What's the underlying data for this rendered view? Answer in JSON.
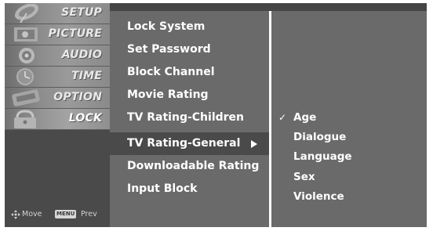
{
  "sidebar": {
    "items": [
      {
        "label": "SETUP",
        "icon": "satellite-dish-icon"
      },
      {
        "label": "PICTURE",
        "icon": "picture-icon"
      },
      {
        "label": "AUDIO",
        "icon": "speaker-icon"
      },
      {
        "label": "TIME",
        "icon": "clock-icon"
      },
      {
        "label": "OPTION",
        "icon": "option-icon"
      },
      {
        "label": "LOCK",
        "icon": "lock-icon"
      }
    ],
    "active": "LOCK"
  },
  "footer": {
    "move_label": "Move",
    "menu_key": "MENU",
    "prev_label": "Prev"
  },
  "submenu": {
    "items": [
      "Lock System",
      "Set Password",
      "Block Channel",
      "Movie Rating",
      "TV Rating-Children",
      "TV Rating-General",
      "Downloadable Rating",
      "Input Block"
    ],
    "selected": "TV Rating-General"
  },
  "options": {
    "items": [
      {
        "label": "Age",
        "checked": true
      },
      {
        "label": "Dialogue",
        "checked": false
      },
      {
        "label": "Language",
        "checked": false
      },
      {
        "label": "Sex",
        "checked": false
      },
      {
        "label": "Violence",
        "checked": false
      }
    ],
    "check_glyph": "✓"
  },
  "colors": {
    "panel": "#6a6a6a",
    "highlight": "#4a4a4a",
    "text": "#ffffff"
  }
}
